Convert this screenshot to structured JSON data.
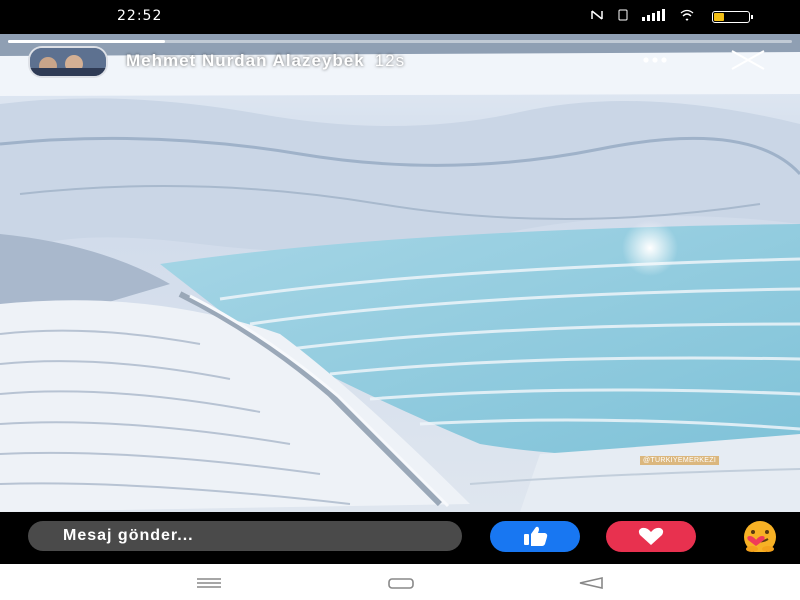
{
  "status_bar": {
    "time": "22:52"
  },
  "story": {
    "author_name": "Mehmet Nurdan Alazeybek",
    "time_ago": "12s",
    "watermark": "@TURKIYEMERKEZI",
    "progress": 0.2
  },
  "reply_bar": {
    "placeholder": "Mesaj gönder..."
  },
  "reactions": [
    "like-icon",
    "love-icon",
    "care-icon"
  ],
  "nav": [
    "recent-apps-icon",
    "home-icon",
    "back-icon"
  ],
  "colors": {
    "like": "#1877f2",
    "love": "#e8314f",
    "care": "#f7b125"
  }
}
